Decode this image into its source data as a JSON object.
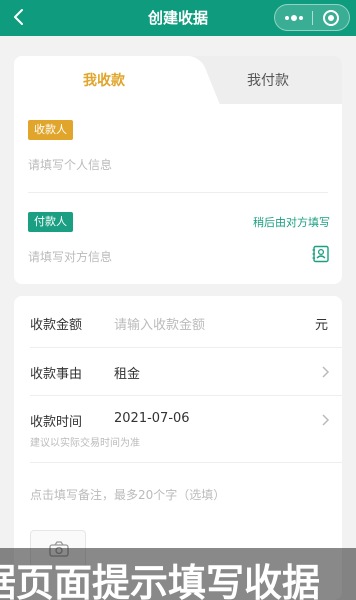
{
  "topbar": {
    "title": "创建收据",
    "bg_color": "#0f9c7e"
  },
  "tabs": {
    "active": "我收款",
    "inactive": "我付款",
    "active_color": "#e0a52a"
  },
  "payee": {
    "badge": "收款人",
    "placeholder": "请填写个人信息",
    "badge_color": "#e0a52a"
  },
  "payer": {
    "badge": "付款人",
    "placeholder": "请填写对方信息",
    "later_link": "稍后由对方填写",
    "badge_color": "#1a9f82"
  },
  "form": {
    "amount": {
      "label": "收款金额",
      "placeholder": "请输入收款金额",
      "unit": "元"
    },
    "reason": {
      "label": "收款事由",
      "value": "租金"
    },
    "time": {
      "label": "收款时间",
      "value": "2021-07-06",
      "hint": "建议以实际交易时间为准"
    },
    "remark_placeholder": "点击填写备注，最多20个字（选填）"
  },
  "banner": {
    "text": "据页面提示填写收据"
  }
}
